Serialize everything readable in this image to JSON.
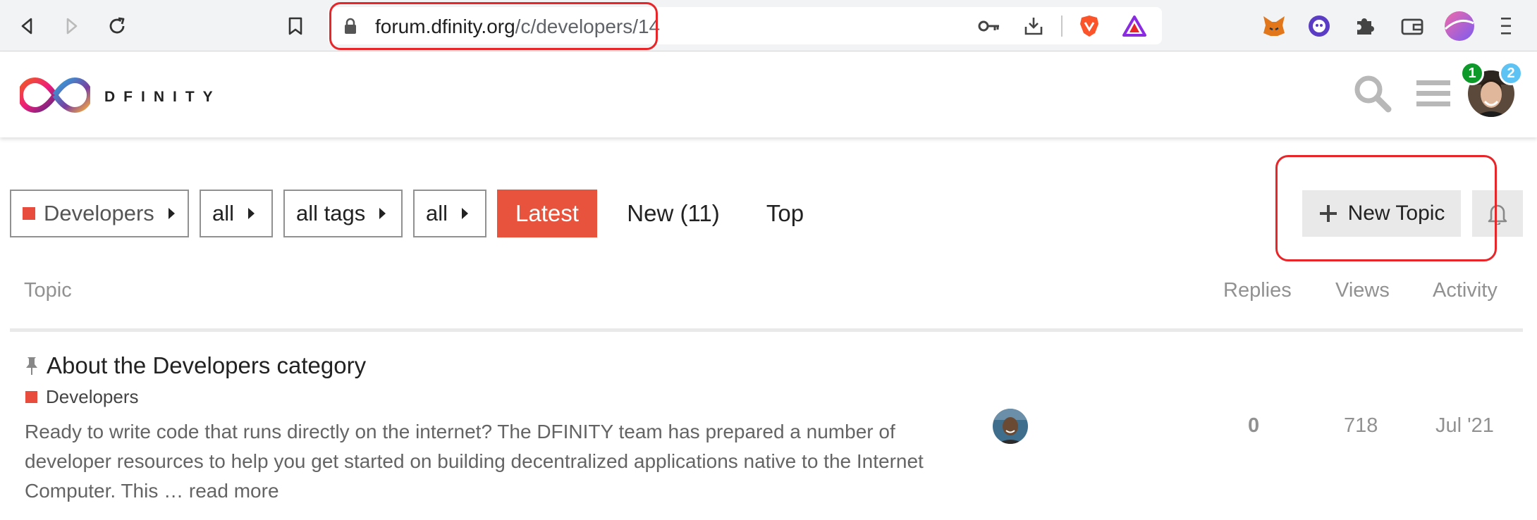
{
  "browser": {
    "url_host": "forum.dfinity.org",
    "url_path": "/c/developers/14"
  },
  "site": {
    "logo_text": "DFINITY",
    "notification_count": "1",
    "message_count": "2",
    "colors": {
      "accent": "#e7533d",
      "category": "#e74c3c",
      "badge_green": "#0e9a2b",
      "badge_blue": "#5dc3f4"
    }
  },
  "nav": {
    "category_label": "Developers",
    "subcategory_label": "all",
    "tags_label": "all tags",
    "filter_label": "all",
    "tabs": [
      "Latest",
      "New (11)",
      "Top"
    ],
    "new_topic_label": "New Topic"
  },
  "table": {
    "headers": {
      "topic": "Topic",
      "replies": "Replies",
      "views": "Views",
      "activity": "Activity"
    },
    "rows": [
      {
        "title": "About the Developers category",
        "category": "Developers",
        "excerpt": "Ready to write code that runs directly on the internet? The DFINITY team has prepared a number of developer resources to help you get started on building decentralized applications native to the Internet Computer. This …",
        "read_more": "read more",
        "replies": "0",
        "views": "718",
        "activity": "Jul '21"
      }
    ]
  }
}
